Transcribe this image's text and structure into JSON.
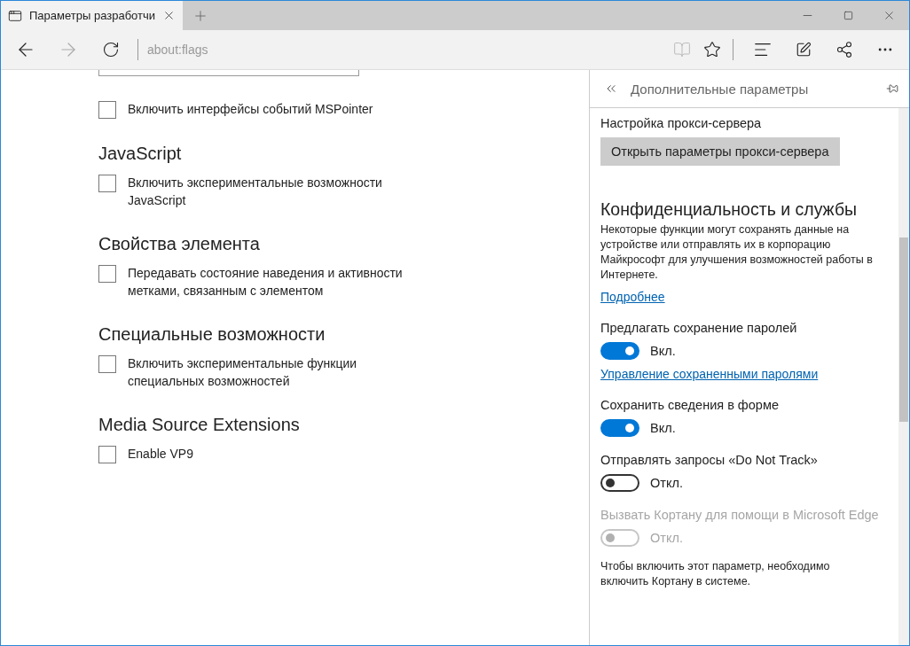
{
  "window": {
    "tab_title": "Параметры разработчи",
    "address": "about:flags"
  },
  "sections": [
    {
      "items": [
        {
          "label": "Включить интерфейсы событий MSPointer",
          "checked": false
        }
      ]
    },
    {
      "heading": "JavaScript",
      "items": [
        {
          "label": "Включить экспериментальные возможности JavaScript",
          "checked": false
        }
      ]
    },
    {
      "heading": "Свойства элемента",
      "items": [
        {
          "label": "Передавать состояние наведения и активности метками, связанным с элементом",
          "checked": false
        }
      ]
    },
    {
      "heading": "Специальные возможности",
      "items": [
        {
          "label": "Включить экспериментальные функции специальных возможностей",
          "checked": false
        }
      ]
    },
    {
      "heading": "Media Source Extensions",
      "items": [
        {
          "label": "Enable VP9",
          "checked": false
        }
      ]
    }
  ],
  "panel": {
    "title": "Дополнительные параметры",
    "items": [
      {
        "kind": "label",
        "text": "Настройка прокси-сервера",
        "disabled": false
      },
      {
        "kind": "button",
        "text": "Открыть параметры прокси-сервера"
      },
      {
        "kind": "heading",
        "text": "Конфиденциальность и службы"
      },
      {
        "kind": "paragraph",
        "text": "Некоторые функции могут сохранять данные на устройстве или отправлять их в корпорацию Майкрософт для улучшения возможностей работы в Интернете."
      },
      {
        "kind": "link",
        "text": "Подробнее"
      },
      {
        "kind": "label",
        "text": "Предлагать сохранение паролей",
        "disabled": false
      },
      {
        "kind": "toggle",
        "on": true,
        "disabled": false,
        "text": "Вкл."
      },
      {
        "kind": "link",
        "text": "Управление сохраненными паролями"
      },
      {
        "kind": "label",
        "text": "Сохранить сведения в форме",
        "disabled": false
      },
      {
        "kind": "toggle",
        "on": true,
        "disabled": false,
        "text": "Вкл."
      },
      {
        "kind": "label",
        "text": "Отправлять запросы «Do Not Track»",
        "disabled": false
      },
      {
        "kind": "toggle",
        "on": false,
        "disabled": false,
        "text": "Откл."
      },
      {
        "kind": "label",
        "text": "Вызвать Кортану для помощи в Microsoft Edge",
        "disabled": true
      },
      {
        "kind": "toggle",
        "on": false,
        "disabled": true,
        "text": "Откл."
      },
      {
        "kind": "note",
        "text": "Чтобы включить этот параметр, необходимо включить Кортану в системе."
      }
    ]
  }
}
